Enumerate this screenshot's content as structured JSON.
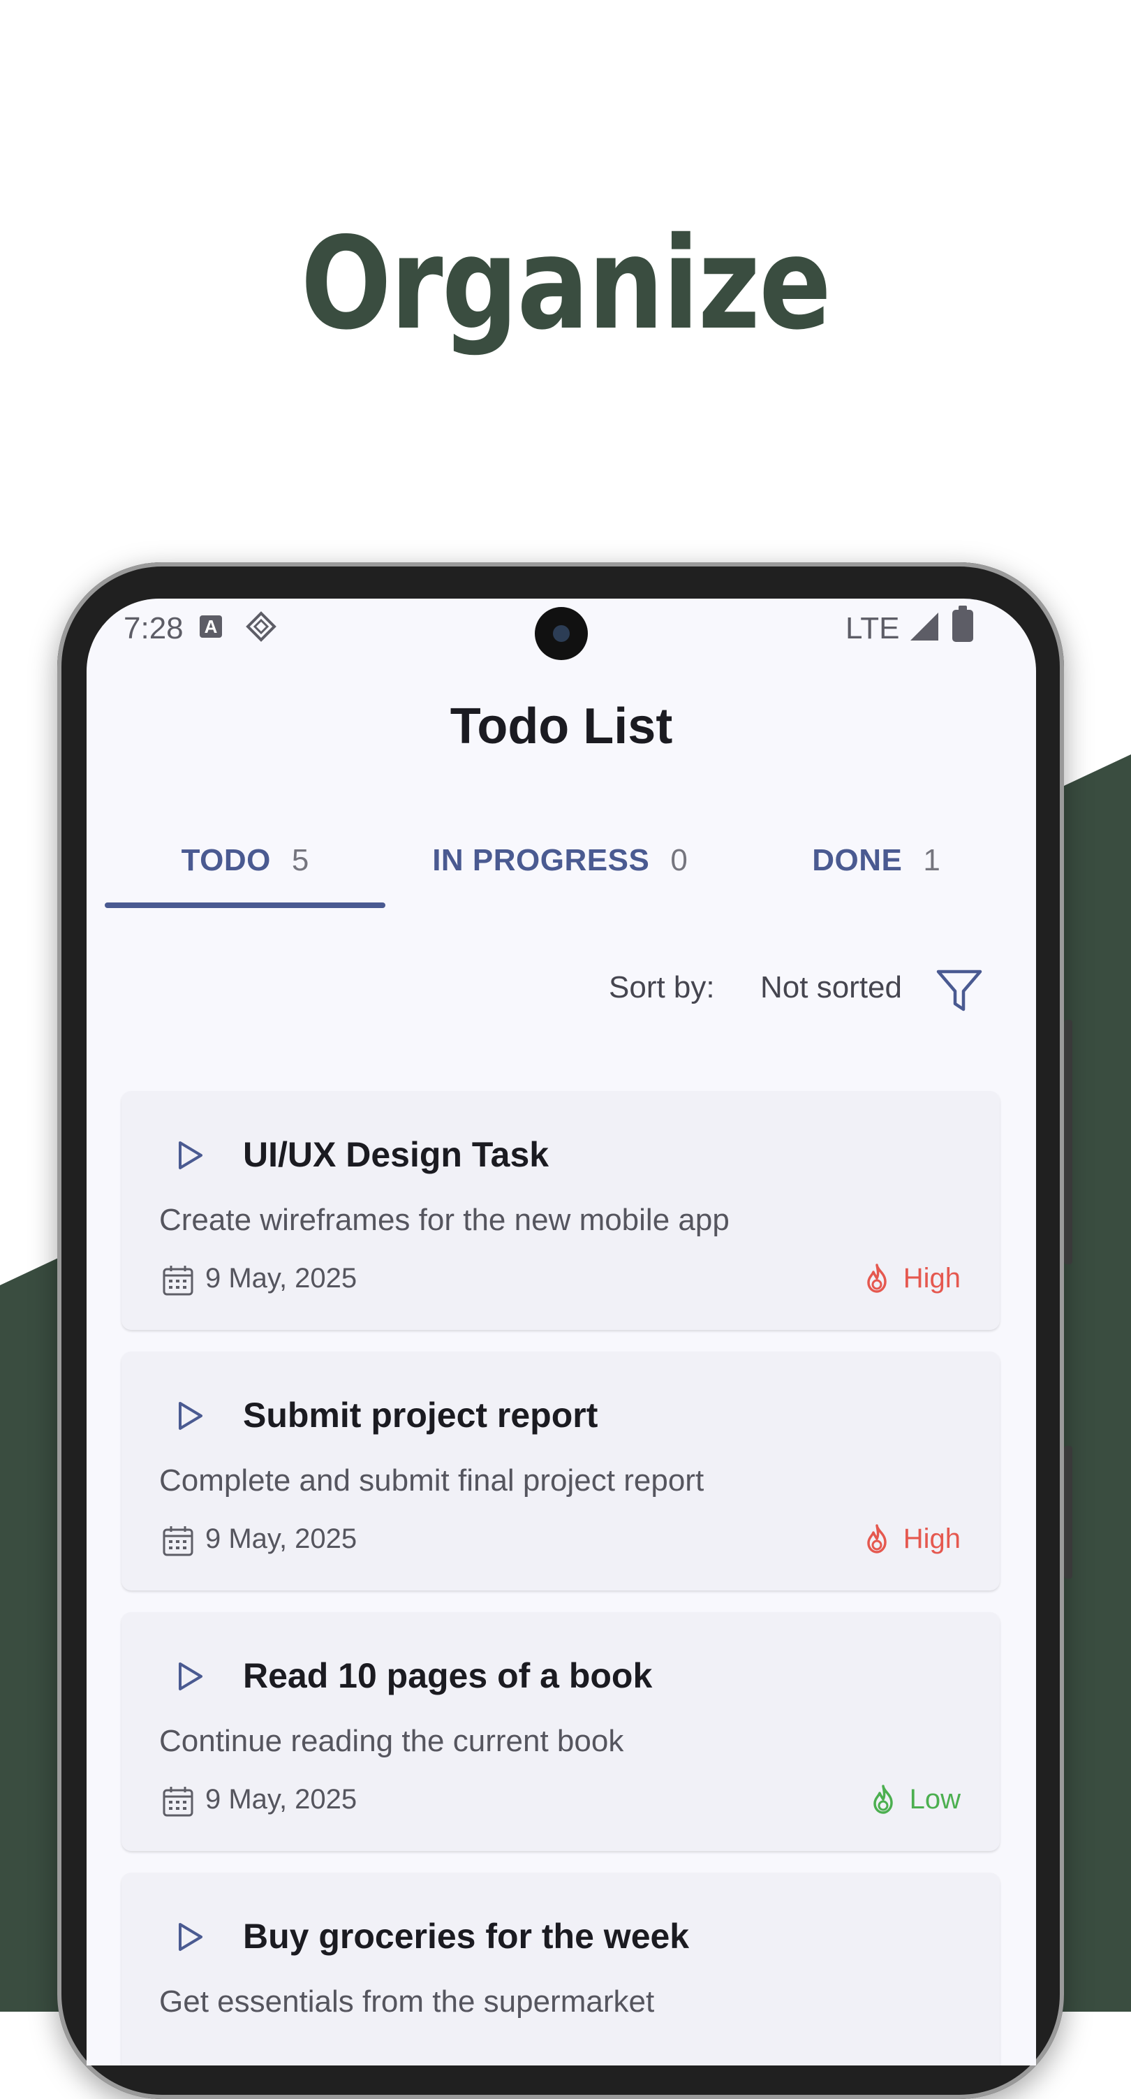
{
  "hero": {
    "title": "Organize"
  },
  "status_bar": {
    "time": "7:28",
    "a_badge": "A",
    "network": "LTE"
  },
  "app": {
    "title": "Todo List"
  },
  "tabs": [
    {
      "label": "TODO",
      "count": "5",
      "selected": true
    },
    {
      "label": "IN PROGRESS",
      "count": "0",
      "selected": false
    },
    {
      "label": "DONE",
      "count": "1",
      "selected": false
    }
  ],
  "sort": {
    "label": "Sort by:",
    "value": "Not sorted"
  },
  "tasks": [
    {
      "title": "UI/UX Design Task",
      "description": "Create wireframes for the new mobile app",
      "date": "9 May, 2025",
      "priority": "High",
      "priority_color": "#e5584f"
    },
    {
      "title": "Submit project report",
      "description": "Complete and submit final project report",
      "date": "9 May, 2025",
      "priority": "High",
      "priority_color": "#e5584f"
    },
    {
      "title": "Read 10 pages of a book",
      "description": "Continue reading the current book",
      "date": "9 May, 2025",
      "priority": "Low",
      "priority_color": "#4caf50"
    },
    {
      "title": "Buy groceries for the week",
      "description": "Get essentials from the supermarket",
      "date": "",
      "priority": "",
      "priority_color": ""
    }
  ],
  "colors": {
    "brand_green": "#3a4d40",
    "tab_accent": "#4a5a91",
    "screen_bg": "#f8f8fd",
    "card_bg": "#f1f1f7"
  }
}
